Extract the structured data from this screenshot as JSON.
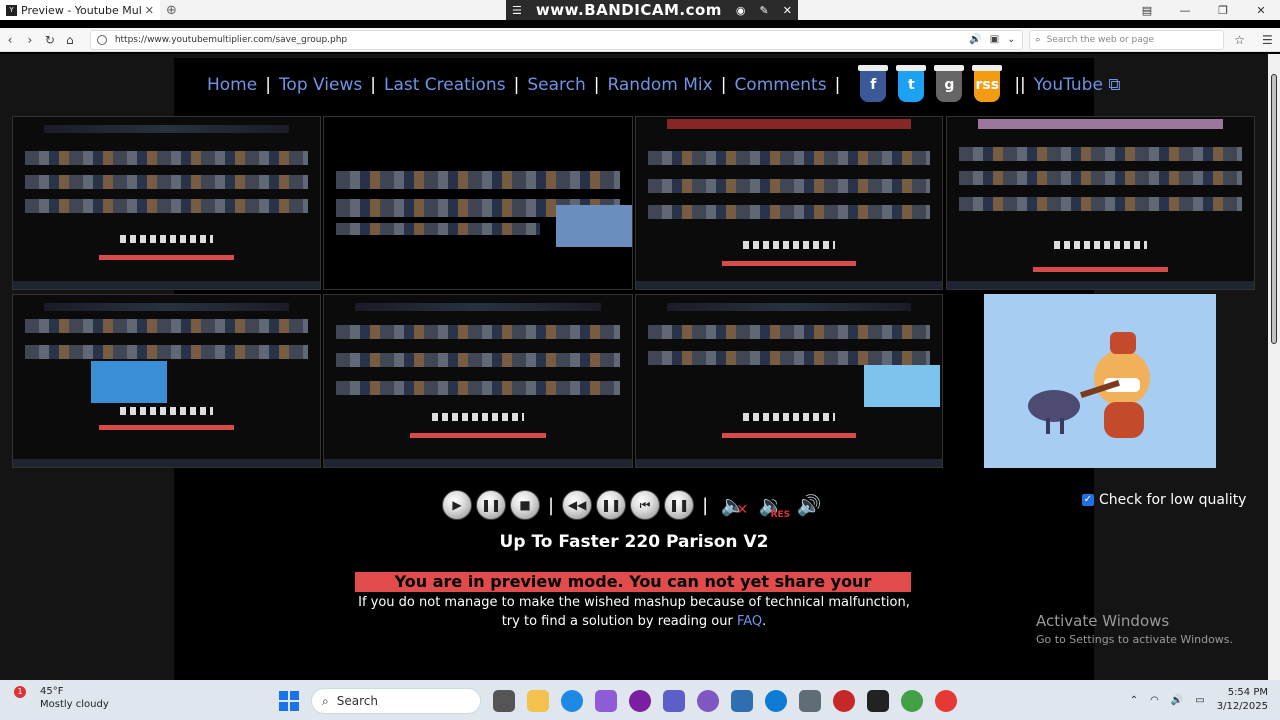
{
  "browser": {
    "tab_title": "Preview - Youtube Multipli",
    "recorder_brand": "www.BANDICAM.com",
    "url": "https://www.youtubemultiplier.com/save_group.php",
    "search_placeholder": "Search the web or page"
  },
  "menu": {
    "items": [
      "Home",
      "Top Views",
      "Last Creations",
      "Search",
      "Random Mix",
      "Comments"
    ],
    "youtube": "YouTube"
  },
  "social": [
    "f",
    "t",
    "g",
    "rss"
  ],
  "player": {
    "low_quality_label": "Check for low quality"
  },
  "creation": {
    "title": "Up To Faster 220 Parison V2",
    "preview_message": "You are in preview mode. You can not yet share your creation",
    "info_line1": "If you do not manage to make the wished mashup because of technical malfunction,",
    "info_line2_prefix": "try to find a solution by reading our",
    "faq": "FAQ",
    "info_line2_suffix": "."
  },
  "watermark": {
    "line1": "Activate Windows",
    "line2": "Go to Settings to activate Windows."
  },
  "taskbar": {
    "weather_badge": "1",
    "temperature": "45°F",
    "condition": "Mostly cloudy",
    "search": "Search",
    "time": "5:54 PM",
    "date": "3/12/2025"
  },
  "colors": {
    "link": "#6f93e6",
    "preview_bg": "#e24b4b",
    "page_bg": "#000000"
  }
}
